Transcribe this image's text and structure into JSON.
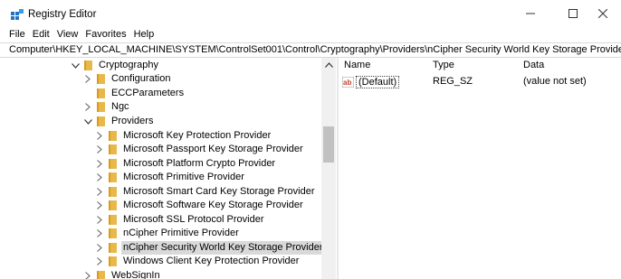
{
  "window": {
    "title": "Registry Editor",
    "controls": [
      "minimize",
      "maximize",
      "close"
    ]
  },
  "menu": [
    {
      "label": "File"
    },
    {
      "label": "Edit"
    },
    {
      "label": "View"
    },
    {
      "label": "Favorites"
    },
    {
      "label": "Help"
    }
  ],
  "address": {
    "path": "Computer\\HKEY_LOCAL_MACHINE\\SYSTEM\\ControlSet001\\Control\\Cryptography\\Providers\\nCipher Security World Key Storage Provider"
  },
  "tree": {
    "items": [
      {
        "label": "Cryptography",
        "expanded": true,
        "has_children": true
      },
      {
        "label": "Configuration",
        "expanded": false,
        "has_children": true
      },
      {
        "label": "ECCParameters",
        "expanded": false,
        "has_children": false
      },
      {
        "label": "Ngc",
        "expanded": false,
        "has_children": true
      },
      {
        "label": "Providers",
        "expanded": true,
        "has_children": true
      },
      {
        "label": "Microsoft Key Protection Provider",
        "expanded": false,
        "has_children": true
      },
      {
        "label": "Microsoft Passport Key Storage Provider",
        "expanded": false,
        "has_children": true
      },
      {
        "label": "Microsoft Platform Crypto Provider",
        "expanded": false,
        "has_children": true
      },
      {
        "label": "Microsoft Primitive Provider",
        "expanded": false,
        "has_children": true
      },
      {
        "label": "Microsoft Smart Card Key Storage Provider",
        "expanded": false,
        "has_children": true
      },
      {
        "label": "Microsoft Software Key Storage Provider",
        "expanded": false,
        "has_children": true
      },
      {
        "label": "Microsoft SSL Protocol Provider",
        "expanded": false,
        "has_children": true
      },
      {
        "label": "nCipher Primitive Provider",
        "expanded": false,
        "has_children": true
      },
      {
        "label": "nCipher Security World Key Storage Provider",
        "expanded": false,
        "has_children": true,
        "selected": true
      },
      {
        "label": "Windows Client Key Protection Provider",
        "expanded": false,
        "has_children": true
      },
      {
        "label": "WebSignIn",
        "expanded": false,
        "has_children": true
      }
    ]
  },
  "list": {
    "columns": [
      "Name",
      "Type",
      "Data"
    ],
    "rows": [
      {
        "name": "(Default)",
        "type": "REG_SZ",
        "data": "(value not set)",
        "icon": "string-value-icon"
      }
    ]
  },
  "colors": {
    "folder": "#e8b84a",
    "selection": "#d9d9d9",
    "ab_icon_red": "#c8402b"
  }
}
